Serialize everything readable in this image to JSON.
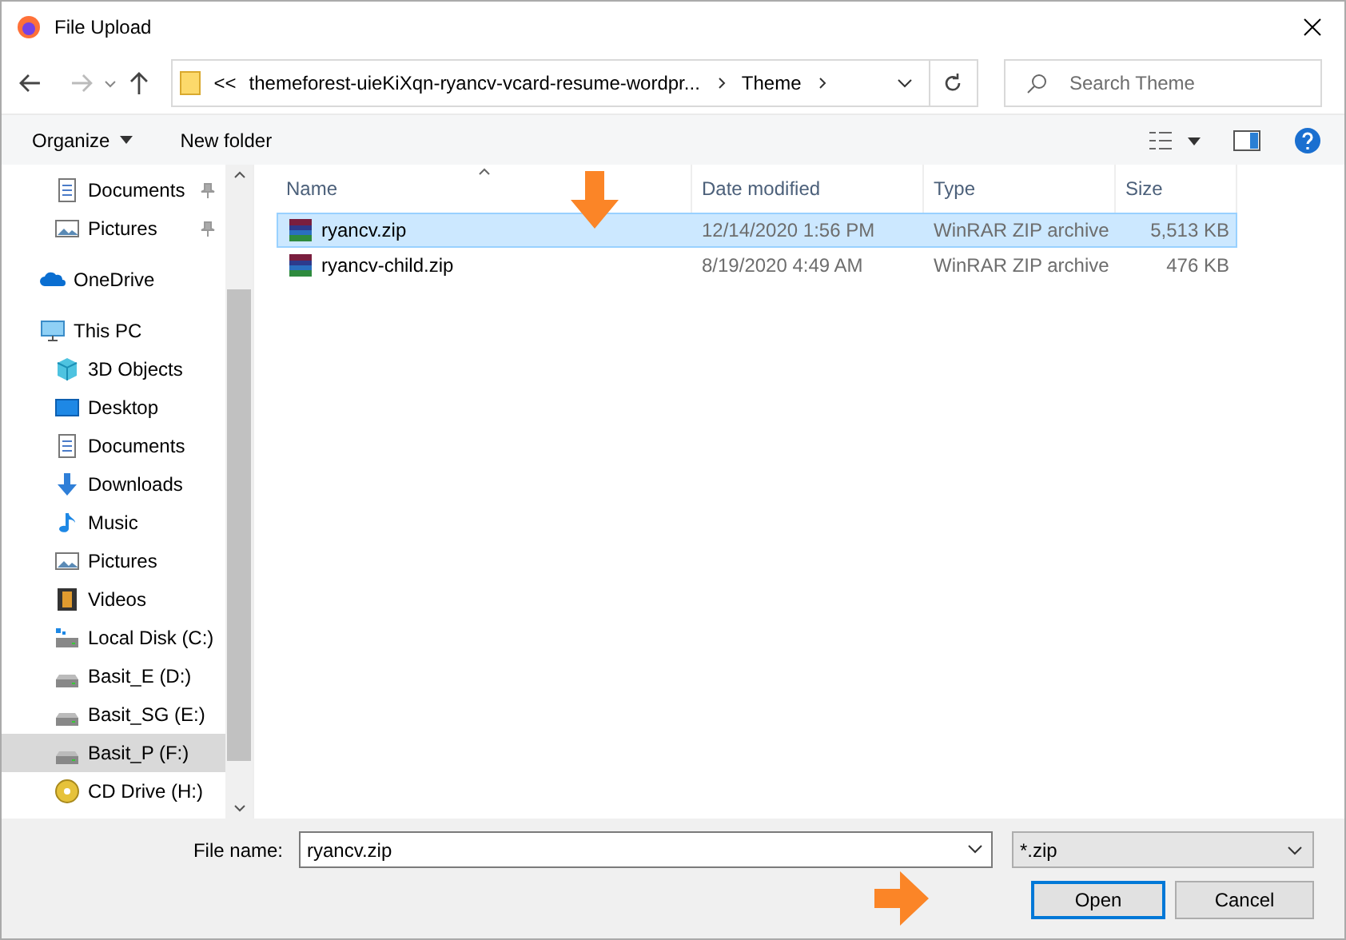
{
  "window": {
    "title": "File Upload"
  },
  "address": {
    "overflow": "<<",
    "segments": [
      "themeforest-uieKiXqn-ryancv-vcard-resume-wordpr...",
      "Theme"
    ]
  },
  "search": {
    "placeholder": "Search Theme"
  },
  "toolbar": {
    "organize": "Organize",
    "new_folder": "New folder"
  },
  "sidebar": {
    "quick_access": [
      {
        "label": "Documents",
        "kind": "document",
        "pinned": true
      },
      {
        "label": "Pictures",
        "kind": "picture",
        "pinned": true
      }
    ],
    "nodes": [
      {
        "label": "OneDrive",
        "kind": "cloud",
        "selected": false
      },
      {
        "label": "This PC",
        "kind": "pc",
        "selected": false,
        "children": [
          {
            "label": "3D Objects",
            "kind": "cube",
            "selected": false
          },
          {
            "label": "Desktop",
            "kind": "desktop",
            "selected": false
          },
          {
            "label": "Documents",
            "kind": "document",
            "selected": false
          },
          {
            "label": "Downloads",
            "kind": "download",
            "selected": false
          },
          {
            "label": "Music",
            "kind": "music",
            "selected": false
          },
          {
            "label": "Pictures",
            "kind": "picture",
            "selected": false
          },
          {
            "label": "Videos",
            "kind": "video",
            "selected": false
          },
          {
            "label": "Local Disk (C:)",
            "kind": "windisk",
            "selected": false
          },
          {
            "label": "Basit_E (D:)",
            "kind": "drive",
            "selected": false
          },
          {
            "label": "Basit_SG (E:)",
            "kind": "drive",
            "selected": false
          },
          {
            "label": "Basit_P (F:)",
            "kind": "drive",
            "selected": true
          },
          {
            "label": "CD Drive (H:)",
            "kind": "cd",
            "selected": false
          }
        ]
      }
    ]
  },
  "table": {
    "columns": [
      "Name",
      "Date modified",
      "Type",
      "Size"
    ],
    "rows": [
      {
        "name": "ryancv.zip",
        "date": "12/14/2020 1:56 PM",
        "type": "WinRAR ZIP archive",
        "size": "5,513 KB",
        "selected": true
      },
      {
        "name": "ryancv-child.zip",
        "date": "8/19/2020 4:49 AM",
        "type": "WinRAR ZIP archive",
        "size": "476 KB",
        "selected": false
      }
    ]
  },
  "footer": {
    "file_name_label": "File name:",
    "file_name": "ryancv.zip",
    "filter": "*.zip",
    "buttons": [
      {
        "label": "Open",
        "focused": true
      },
      {
        "label": "Cancel",
        "focused": false
      }
    ]
  }
}
